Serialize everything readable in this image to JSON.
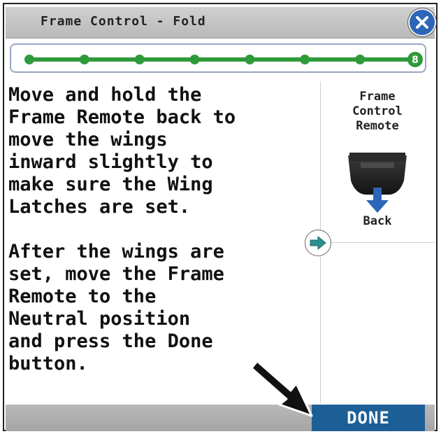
{
  "header": {
    "title": "Frame Control - Fold",
    "close_icon": "close-icon"
  },
  "progress": {
    "current_step": 8,
    "total_steps": 8,
    "current_label": "8",
    "color": "#2f9a3a"
  },
  "instructions": {
    "text": "Move and hold the\nFrame Remote back to\nmove the wings\ninward slightly to\nmake sure the Wing\nLatches are set.\n\nAfter the wings are\nset, move the Frame\nRemote to the\nNeutral position\nand press the Done\nbutton."
  },
  "side_panel": {
    "title": "Frame\nControl\nRemote",
    "icon": "frame-remote-lever-icon",
    "direction_label": "Back",
    "arrow_color": "#2b66b8"
  },
  "footer": {
    "done_label": "DONE",
    "done_color": "#1c5f97"
  },
  "colors": {
    "accent_blue": "#2b66b8",
    "progress_green": "#2f9a3a",
    "arrow_teal": "#2a8f8f"
  }
}
